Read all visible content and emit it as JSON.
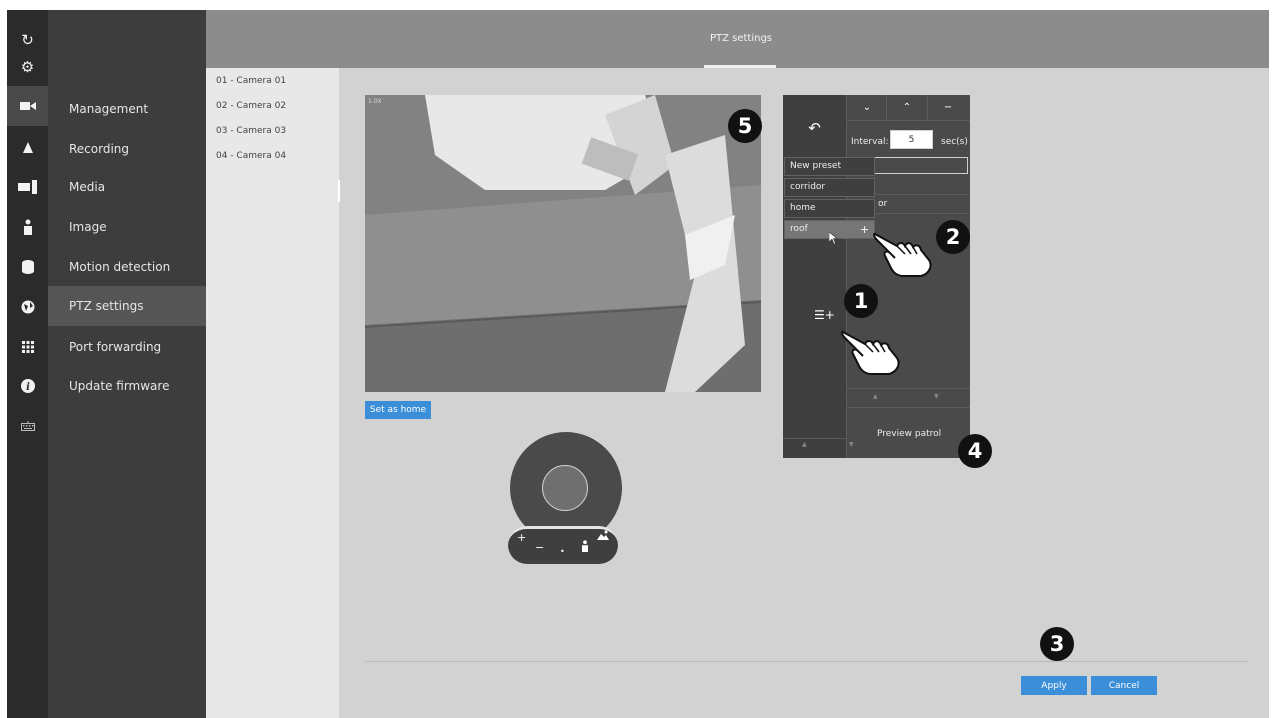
{
  "header": {
    "title": "PTZ settings"
  },
  "rail": {
    "icons": [
      "refresh-icon",
      "gear-icon",
      "camera-icon",
      "bell-icon",
      "display-icon",
      "person-icon",
      "database-icon",
      "globe-icon",
      "grid-icon",
      "info-icon",
      "keyboard-icon"
    ]
  },
  "sidebar": {
    "items": [
      {
        "label": "Management"
      },
      {
        "label": "Recording"
      },
      {
        "label": "Media"
      },
      {
        "label": "Image"
      },
      {
        "label": "Motion detection"
      },
      {
        "label": "PTZ settings"
      },
      {
        "label": "Port forwarding"
      },
      {
        "label": "Update firmware"
      }
    ],
    "active": "PTZ settings"
  },
  "cameras": [
    "01 - Camera 01",
    "02 - Camera 02",
    "03 - Camera 03",
    "04 - Camera 04"
  ],
  "video": {
    "overlay": "1.0X"
  },
  "set_home_label": "Set as home",
  "joystick": {
    "zoom_in": "+",
    "zoom_out": "−",
    "dot": "•"
  },
  "preset_panel": {
    "back_icon": "↶",
    "down_icon": "⌄",
    "up_icon": "⌃",
    "remove_icon": "−",
    "interval_label": "Interval:",
    "interval_value": "5",
    "interval_unit": "sec(s)",
    "dropdown": [
      "New preset",
      "corridor",
      "home",
      "roof"
    ],
    "dropdown_add": "+",
    "right_row_partial": "or",
    "add_list_icon": "☰+",
    "preview_patrol": "Preview patrol",
    "arrow_up": "▲",
    "arrow_down": "▼"
  },
  "footer": {
    "apply": "Apply",
    "cancel": "Cancel"
  },
  "callouts": [
    "1",
    "2",
    "3",
    "4",
    "5"
  ],
  "colors": {
    "accent": "#3a8fd8",
    "sidebar": "#3d3d3d",
    "rail": "#2b2b2b",
    "header": "#8c8c8c"
  }
}
